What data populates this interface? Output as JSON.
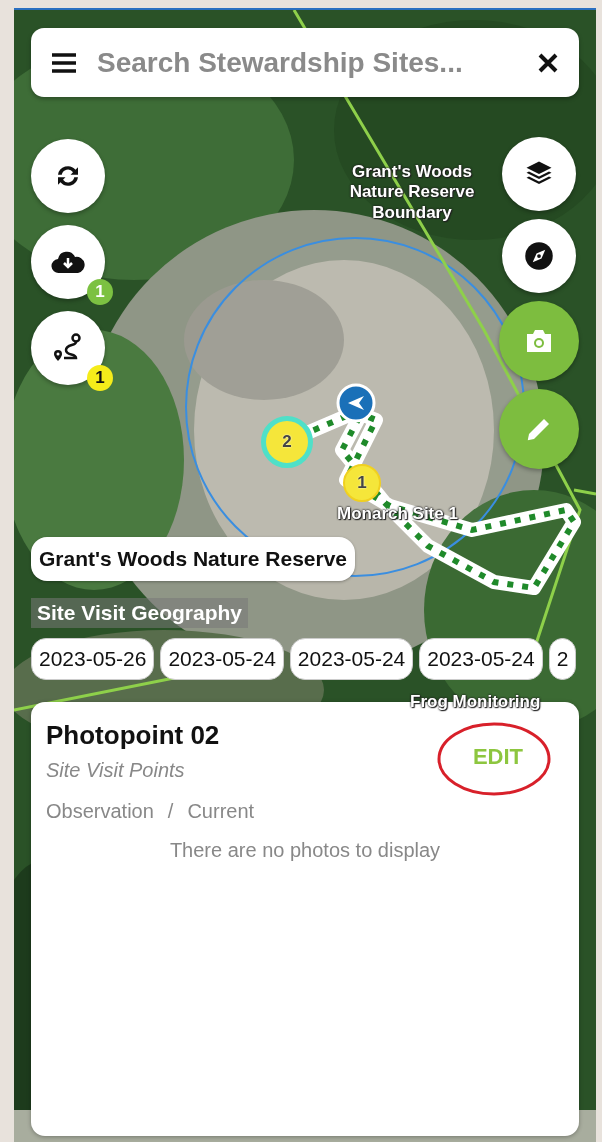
{
  "search": {
    "placeholder": "Search Stewardship Sites..."
  },
  "left_buttons": [
    {
      "kind": "refresh"
    },
    {
      "kind": "download",
      "badge": "1",
      "color": "#7cc142"
    },
    {
      "kind": "route",
      "badge": "1",
      "color": "#f5ec1a"
    }
  ],
  "right_buttons": [
    {
      "kind": "layers"
    },
    {
      "kind": "compass"
    },
    {
      "kind": "camera"
    },
    {
      "kind": "edit"
    }
  ],
  "map_labels": [
    {
      "text": "Grant's Woods Nature Reserve Boundary"
    },
    {
      "text": "Monarch Site 1"
    },
    {
      "text": "Frog Monitoring"
    }
  ],
  "clusters": [
    {
      "count": "2",
      "selected": true
    },
    {
      "count": "1",
      "selected": false
    }
  ],
  "area_chip": "Grant's Woods Nature Reserve",
  "geography_title": "Site Visit Geography",
  "dates": [
    {
      "label": "2023-05-26"
    },
    {
      "label": "2023-05-24"
    },
    {
      "label": "2023-05-24"
    },
    {
      "label": "2023-05-24"
    },
    {
      "label": "2"
    }
  ],
  "panel": {
    "title": "Photopoint 02",
    "subtitle": "Site Visit Points",
    "breadcrumb": [
      "Observation",
      "Current"
    ],
    "separator": "/",
    "empty": "There are no photos to display",
    "action": "EDIT",
    "action_highlighted": true
  }
}
